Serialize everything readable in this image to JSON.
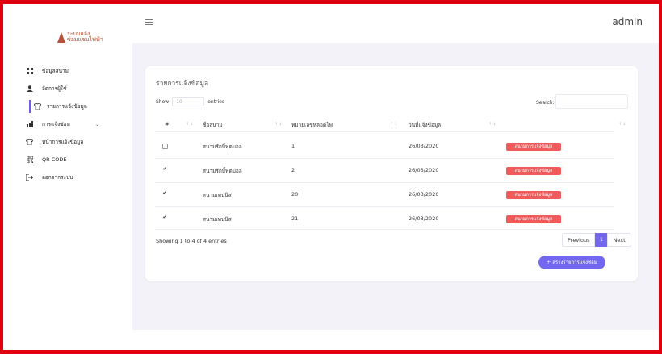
{
  "app": {
    "logo_line1": "ระบบแจ้ง",
    "logo_line2": "ซ่อมแซมไฟฟ้า",
    "user": "admin"
  },
  "sidebar": {
    "items": [
      {
        "label": "ข้อมูลสนาม",
        "icon": "grid-icon"
      },
      {
        "label": "จัดการผู้ใช้",
        "icon": "user-icon"
      },
      {
        "label": "รายการแจ้งข้อมูล",
        "icon": "shirt-icon",
        "active": true
      },
      {
        "label": "การแจ้งซ่อม",
        "icon": "chart-icon",
        "has_children": true
      },
      {
        "label": "หน้าการแจ้งข้อมูล",
        "icon": "shirt-icon"
      },
      {
        "label": "QR CODE",
        "icon": "qrcode-icon"
      },
      {
        "label": "ออกจากระบบ",
        "icon": "logout-icon"
      }
    ]
  },
  "card": {
    "title": "รายการแจ้งข้อมูล",
    "show_label": "Show",
    "show_value": "10",
    "entries_label": "entries",
    "search_label": "Search:",
    "columns": [
      "#",
      "ชื่อสนาม",
      "หมายเลขหลอดไฟ",
      "วันที่แจ้งข้อมูล",
      ""
    ],
    "rows": [
      {
        "checked": false,
        "name": "สนามรักบี้ฟุตบอล",
        "number": "1",
        "date": "26/03/2020",
        "status": "สนามการแจ้งข้อมูล"
      },
      {
        "checked": true,
        "name": "สนามรักบี้ฟุตบอล",
        "number": "2",
        "date": "26/03/2020",
        "status": "สนามการแจ้งข้อมูล"
      },
      {
        "checked": true,
        "name": "สนามเทนนิส",
        "number": "20",
        "date": "26/03/2020",
        "status": "สนามการแจ้งข้อมูล"
      },
      {
        "checked": true,
        "name": "สนามเทนนิส",
        "number": "21",
        "date": "26/03/2020",
        "status": "สนามการแจ้งข้อมูล"
      }
    ],
    "info": "Showing 1 to 4 of 4 entries",
    "pager": {
      "previous": "Previous",
      "page": "1",
      "next": "Next"
    },
    "create_button": "+ สร้างรายการแจ้งซ่อม"
  },
  "colors": {
    "accent": "#7367f0",
    "badge": "#f05a5a",
    "frame": "#e0000f"
  }
}
